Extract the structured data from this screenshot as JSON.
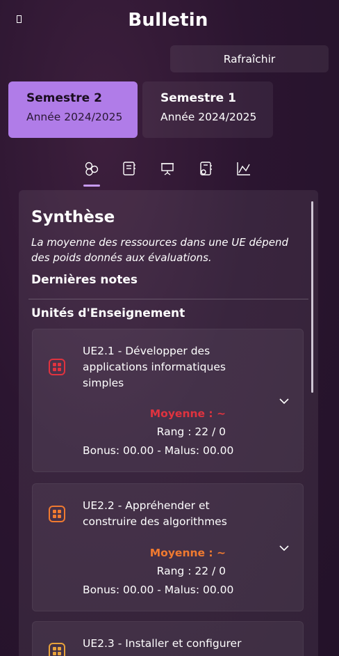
{
  "header": {
    "title": "Bulletin",
    "refresh_label": "Rafraîchir"
  },
  "semesters": [
    {
      "name": "Semestre 2",
      "year": "Année 2024/2025",
      "active": true
    },
    {
      "name": "Semestre 1",
      "year": "Année 2024/2025",
      "active": false
    }
  ],
  "tabs": [
    {
      "icon": "synthesis-icon",
      "active": true
    },
    {
      "icon": "notebook-icon",
      "active": false
    },
    {
      "icon": "presentation-icon",
      "active": false
    },
    {
      "icon": "resource-icon",
      "active": false
    },
    {
      "icon": "chart-icon",
      "active": false
    }
  ],
  "synthese": {
    "title": "Synthèse",
    "subtitle": "La moyenne des ressources dans une UE dépend des poids donnés aux évaluations.",
    "last_grades": "Dernières notes",
    "ue_heading": "Unités d'Enseignement"
  },
  "ues": [
    {
      "name": "UE2.1 - Développer des applications informatiques simples",
      "moyenne": "Moyenne : ~",
      "rang": "Rang : 22 / 0",
      "bonus": "Bonus: 00.00 - Malus: 00.00",
      "color": "#e0333f"
    },
    {
      "name": "UE2.2 - Appréhender et construire des algorithmes",
      "moyenne": "Moyenne : ~",
      "rang": "Rang : 22 / 0",
      "bonus": "Bonus: 00.00 - Malus: 00.00",
      "color": "#f07a30"
    },
    {
      "name": "UE2.3 - Installer et configurer",
      "color": "#e8a23a"
    }
  ]
}
